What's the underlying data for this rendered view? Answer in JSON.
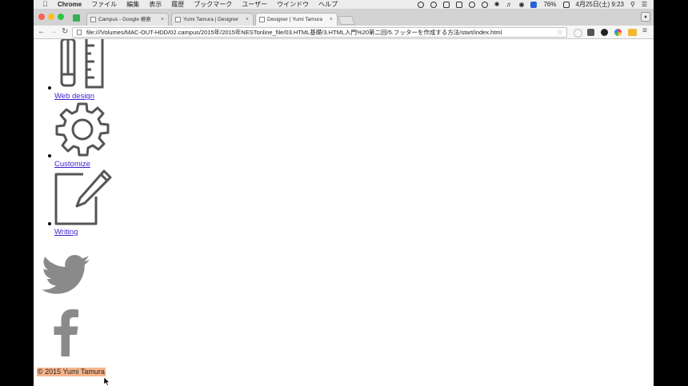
{
  "menubar": {
    "app_name": "Chrome",
    "items": [
      "ファイル",
      "編集",
      "表示",
      "履歴",
      "ブックマーク",
      "ユーザー",
      "ウインドウ",
      "ヘルプ"
    ],
    "battery": "76%",
    "datetime": "4月25日(土) 9:23"
  },
  "tabs": [
    {
      "title": "Campus - Google 検索",
      "active": false
    },
    {
      "title": "Yumi Tamura | Designer",
      "active": false
    },
    {
      "title": "Designer | Yumi Tamura",
      "active": true
    }
  ],
  "address_bar": {
    "url": "file:///Volumes/MAC-OUT-HDD/02.campus/2015年/2015年NESTonline_file/03.HTML基礎/3.HTML入門%20第二回/5.フッターを作成する方法/start/index.html"
  },
  "page": {
    "services": [
      {
        "label": "Web design",
        "icon": "pencil-ruler-icon"
      },
      {
        "label": "Customize",
        "icon": "gear-icon"
      },
      {
        "label": "Writing",
        "icon": "edit-icon"
      }
    ],
    "social": [
      {
        "icon": "twitter-icon"
      },
      {
        "icon": "facebook-icon"
      }
    ],
    "footer_text": "© 2015 Yumi Tamura",
    "colors": {
      "link": "#3a1fd0",
      "icon_gray": "#555555",
      "social_gray": "#8a8a8a",
      "footer_bg": "#f7b48a"
    }
  }
}
